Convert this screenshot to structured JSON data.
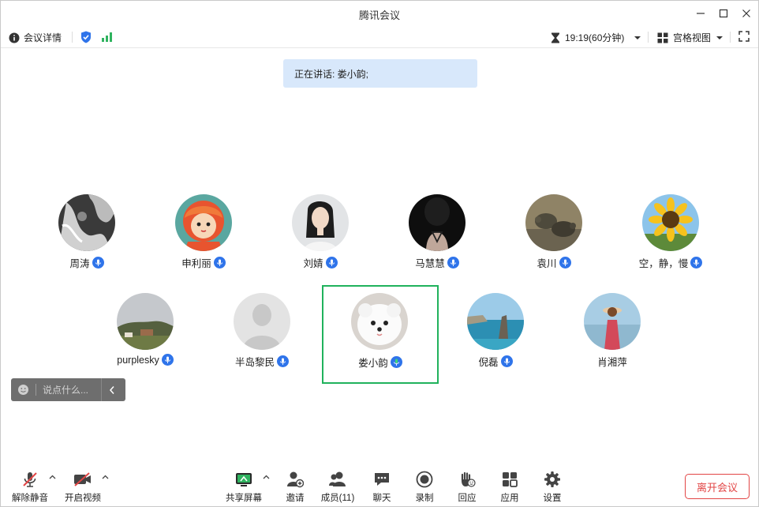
{
  "window": {
    "title": "腾讯会议"
  },
  "infobar": {
    "meeting_details": "会议详情",
    "timer": "19:19(60分钟)",
    "view_mode": "宫格视图"
  },
  "speaker_banner": "正在讲话: 娄小韵;",
  "participants": [
    {
      "name": "周涛"
    },
    {
      "name": "申利丽"
    },
    {
      "name": "刘婧"
    },
    {
      "name": "马慧慧"
    },
    {
      "name": "袁川"
    },
    {
      "name": "空，静，慢"
    },
    {
      "name": "purplesky"
    },
    {
      "name": "半岛黎民"
    },
    {
      "name": "娄小韵"
    },
    {
      "name": "倪磊"
    },
    {
      "name": "肖湘萍"
    }
  ],
  "chat": {
    "placeholder": "说点什么..."
  },
  "toolbar": {
    "mute": "解除静音",
    "video": "开启视频",
    "share": "共享屏幕",
    "invite": "邀请",
    "members": "成员(11)",
    "chat": "聊天",
    "record": "录制",
    "react": "回应",
    "apps": "应用",
    "settings": "设置",
    "leave": "离开会议"
  },
  "colors": {
    "accent_blue": "#2f74ea",
    "active_speaker_border": "#20b25c",
    "banner_bg": "#d8e8fb",
    "leave_red": "#e24545"
  }
}
